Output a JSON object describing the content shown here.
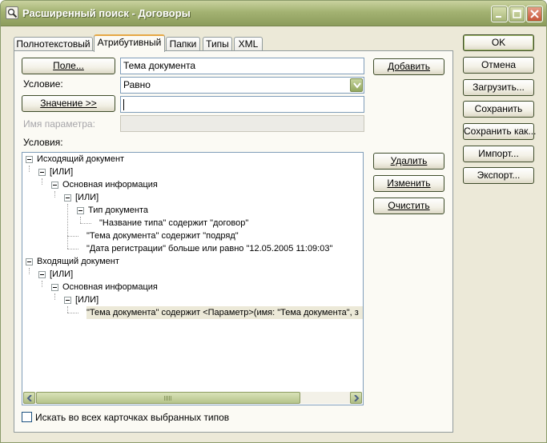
{
  "window": {
    "title": "Расширенный поиск - Договоры",
    "controls": {
      "minimize": "minimize-icon",
      "maximize": "maximize-icon",
      "close": "close-icon"
    }
  },
  "tabs": [
    {
      "label": "Полнотекстовый"
    },
    {
      "label": "Атрибутивный",
      "active": true
    },
    {
      "label": "Папки"
    },
    {
      "label": "Типы"
    },
    {
      "label": "XML"
    }
  ],
  "form": {
    "field_button": "Поле...",
    "field_value": "Тема документа",
    "condition_label": "Условие:",
    "condition_value": "Равно",
    "value_button": "Значение >>",
    "value_input": "",
    "param_name_label": "Имя параметра:",
    "param_name_value": "",
    "conditions_label": "Условия:"
  },
  "side_buttons": {
    "add": "Добавить",
    "delete": "Удалить",
    "change": "Изменить",
    "clear": "Очистить"
  },
  "right_buttons": {
    "ok": "OK",
    "cancel": "Отмена",
    "load": "Загрузить...",
    "save": "Сохранить",
    "save_as": "Сохранить как...",
    "import": "Импорт...",
    "export": "Экспорт..."
  },
  "tree": [
    {
      "text": "Исходящий документ",
      "level": 0,
      "expandable": true
    },
    {
      "text": "[ИЛИ]",
      "level": 1,
      "expandable": true
    },
    {
      "text": "Основная информация",
      "level": 2,
      "expandable": true
    },
    {
      "text": "[ИЛИ]",
      "level": 3,
      "expandable": true
    },
    {
      "text": "Тип документа",
      "level": 4,
      "expandable": true
    },
    {
      "text": "\"Название типа\" содержит \"договор\"",
      "level": 5,
      "expandable": false
    },
    {
      "text": "\"Тема документа\" содержит \"подряд\"",
      "level": 4,
      "expandable": false
    },
    {
      "text": "\"Дата регистрации\" больше или равно \"12.05.2005 11:09:03\"",
      "level": 4,
      "expandable": false
    },
    {
      "text": "Входящий документ",
      "level": 0,
      "expandable": true
    },
    {
      "text": "[ИЛИ]",
      "level": 1,
      "expandable": true
    },
    {
      "text": "Основная информация",
      "level": 2,
      "expandable": true
    },
    {
      "text": "[ИЛИ]",
      "level": 3,
      "expandable": true
    },
    {
      "text": "\"Тема документа\" содержит <Параметр>(имя: \"Тема документа\", з",
      "level": 4,
      "expandable": false,
      "selected": true
    }
  ],
  "checkbox": {
    "label": "Искать во всех карточках выбранных типов",
    "checked": false
  },
  "colors": {
    "titlebar": "#a3b272",
    "dialog_bg": "#ECE9D8",
    "tab_highlight": "#e6a845"
  }
}
